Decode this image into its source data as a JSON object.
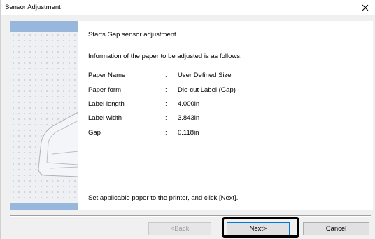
{
  "window": {
    "title": "Sensor Adjustment"
  },
  "content": {
    "intro": "Starts Gap sensor adjustment.",
    "info": "Information of the paper to be adjusted is as follows.",
    "details": [
      {
        "label": "Paper Name",
        "sep": ":",
        "value": "User Defined Size"
      },
      {
        "label": "Paper form",
        "sep": ":",
        "value": "Die-cut Label (Gap)"
      },
      {
        "label": "Label length",
        "sep": ":",
        "value": "4.000in"
      },
      {
        "label": "Label width",
        "sep": ":",
        "value": "3.843in"
      },
      {
        "label": "Gap",
        "sep": ":",
        "value": "0.118in"
      }
    ],
    "instruction": "Set applicable paper to the printer, and click [Next]."
  },
  "buttons": {
    "back": "<Back",
    "next": "Next>",
    "cancel": "Cancel"
  },
  "colors": {
    "side_band": "#98b7dc",
    "side_bg": "#eef0f4",
    "dialog_bg": "#f0f0f0",
    "highlight": "#000000"
  }
}
